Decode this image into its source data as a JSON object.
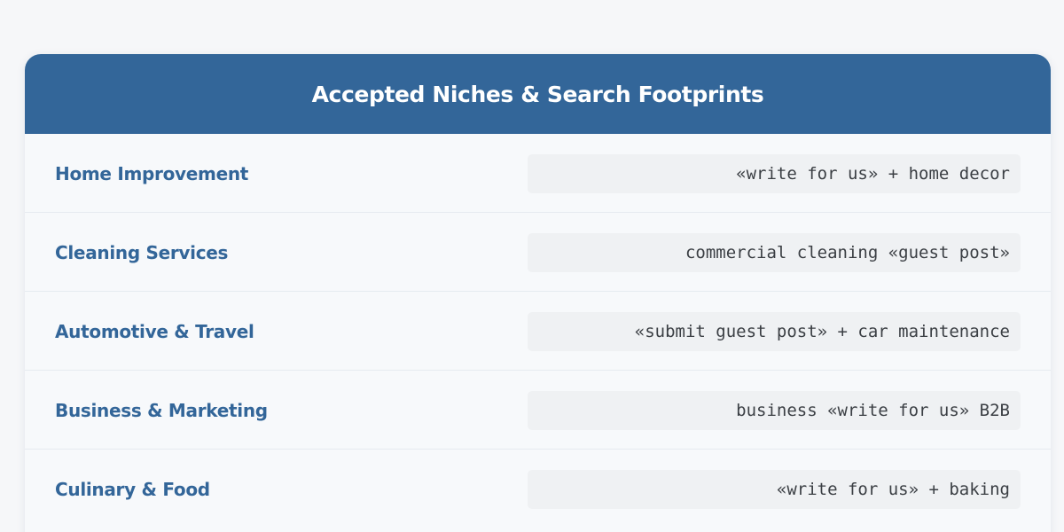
{
  "title": "Accepted Niches & Search Footprints",
  "niches": [
    {
      "label": "Home Improvement",
      "footprint": "«write for us» + home decor"
    },
    {
      "label": "Cleaning Services",
      "footprint": "commercial cleaning «guest post»"
    },
    {
      "label": "Automotive & Travel",
      "footprint": "«submit guest post» + car maintenance"
    },
    {
      "label": "Business & Marketing",
      "footprint": "business «write for us» B2B"
    },
    {
      "label": "Culinary & Food",
      "footprint": "«write for us» + baking"
    }
  ],
  "colors": {
    "header_bg": "#336699",
    "accent_text": "#336699",
    "footprint_bg": "#eff1f3"
  }
}
